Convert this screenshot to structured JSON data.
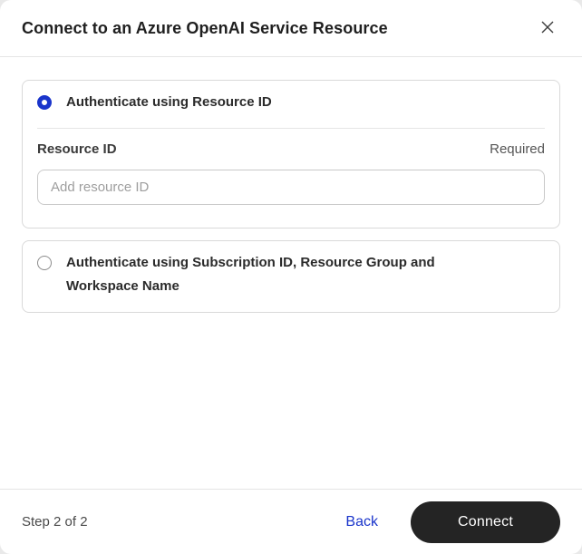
{
  "modal": {
    "title": "Connect to an Azure OpenAI Service Resource"
  },
  "options": [
    {
      "label": "Authenticate using Resource ID",
      "selected": true,
      "field": {
        "label": "Resource ID",
        "required_label": "Required",
        "placeholder": "Add resource ID",
        "value": ""
      }
    },
    {
      "label": "Authenticate using Subscription ID, Resource Group and Workspace Name",
      "selected": false
    }
  ],
  "footer": {
    "step_label": "Step 2 of 2",
    "back_label": "Back",
    "connect_label": "Connect"
  },
  "colors": {
    "accent_blue": "#1a35cb",
    "button_dark": "#242424",
    "page_background": "#e9e9e9"
  }
}
